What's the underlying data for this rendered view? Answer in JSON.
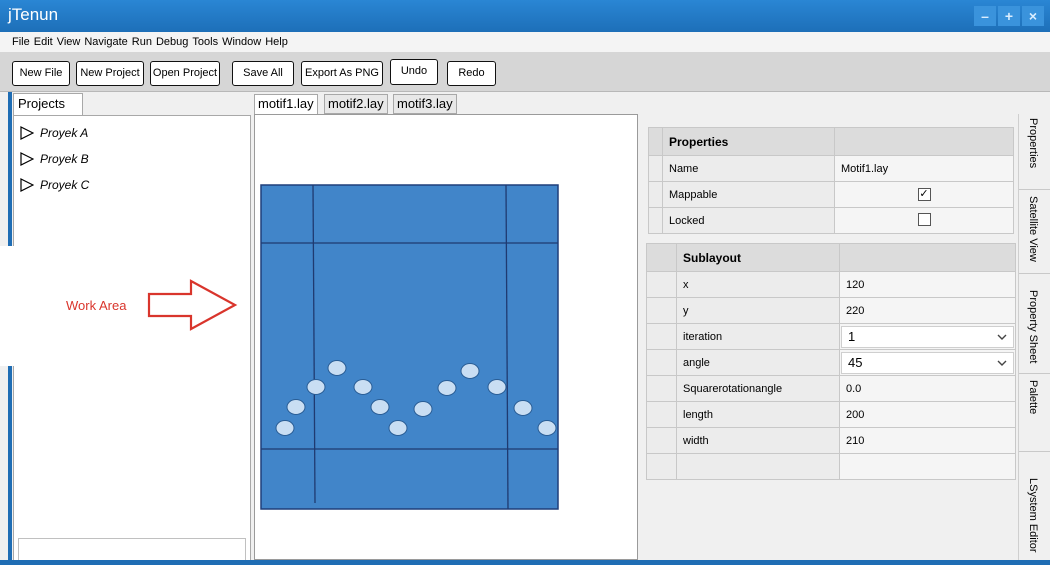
{
  "window": {
    "title": "jTenun",
    "buttons": [
      "–",
      "+",
      "×"
    ]
  },
  "menu": [
    "File",
    "Edit",
    "View",
    "Navigate",
    "Run",
    "Debug",
    "Tools",
    "Window",
    "Help"
  ],
  "toolbar": {
    "new_file": "New File",
    "new_project": "New Project",
    "open_project": "Open Project",
    "save_all": "Save All",
    "export_png": "Export As PNG",
    "undo": "Undo",
    "redo": "Redo"
  },
  "projects": {
    "tab": "Projects",
    "items": [
      "Proyek A",
      "Proyek B",
      "Proyek C"
    ]
  },
  "editor": {
    "tabs": [
      "motif1.lay",
      "motif2.lay",
      "motif3.lay"
    ],
    "canvas_color": "#4185c9"
  },
  "annotation": {
    "label": "Work Area",
    "color": "#d9352c"
  },
  "properties": {
    "header": "Properties",
    "rows": [
      {
        "name": "Name",
        "value": "Motif1.lay"
      },
      {
        "name": "Mappable",
        "checked": true
      },
      {
        "name": "Locked",
        "checked": false
      }
    ]
  },
  "sublayout": {
    "header": "Sublayout",
    "x": {
      "label": "x",
      "value": "120"
    },
    "y": {
      "label": "y",
      "value": "220"
    },
    "iteration": {
      "label": "iteration",
      "value": "1"
    },
    "angle": {
      "label": "angle",
      "value": "45"
    },
    "squarerotation": {
      "label": "Squarerotationangle",
      "value": "0.0"
    },
    "length": {
      "label": "length",
      "value": "200"
    },
    "width": {
      "label": "width",
      "value": "210"
    }
  },
  "side_tabs": [
    "Properties",
    "Satellite View",
    "Property Sheet",
    "Palette",
    "LSystem Editor"
  ],
  "colors": {
    "accent": "#1f6db4",
    "title_bar": "#2a86d4"
  }
}
